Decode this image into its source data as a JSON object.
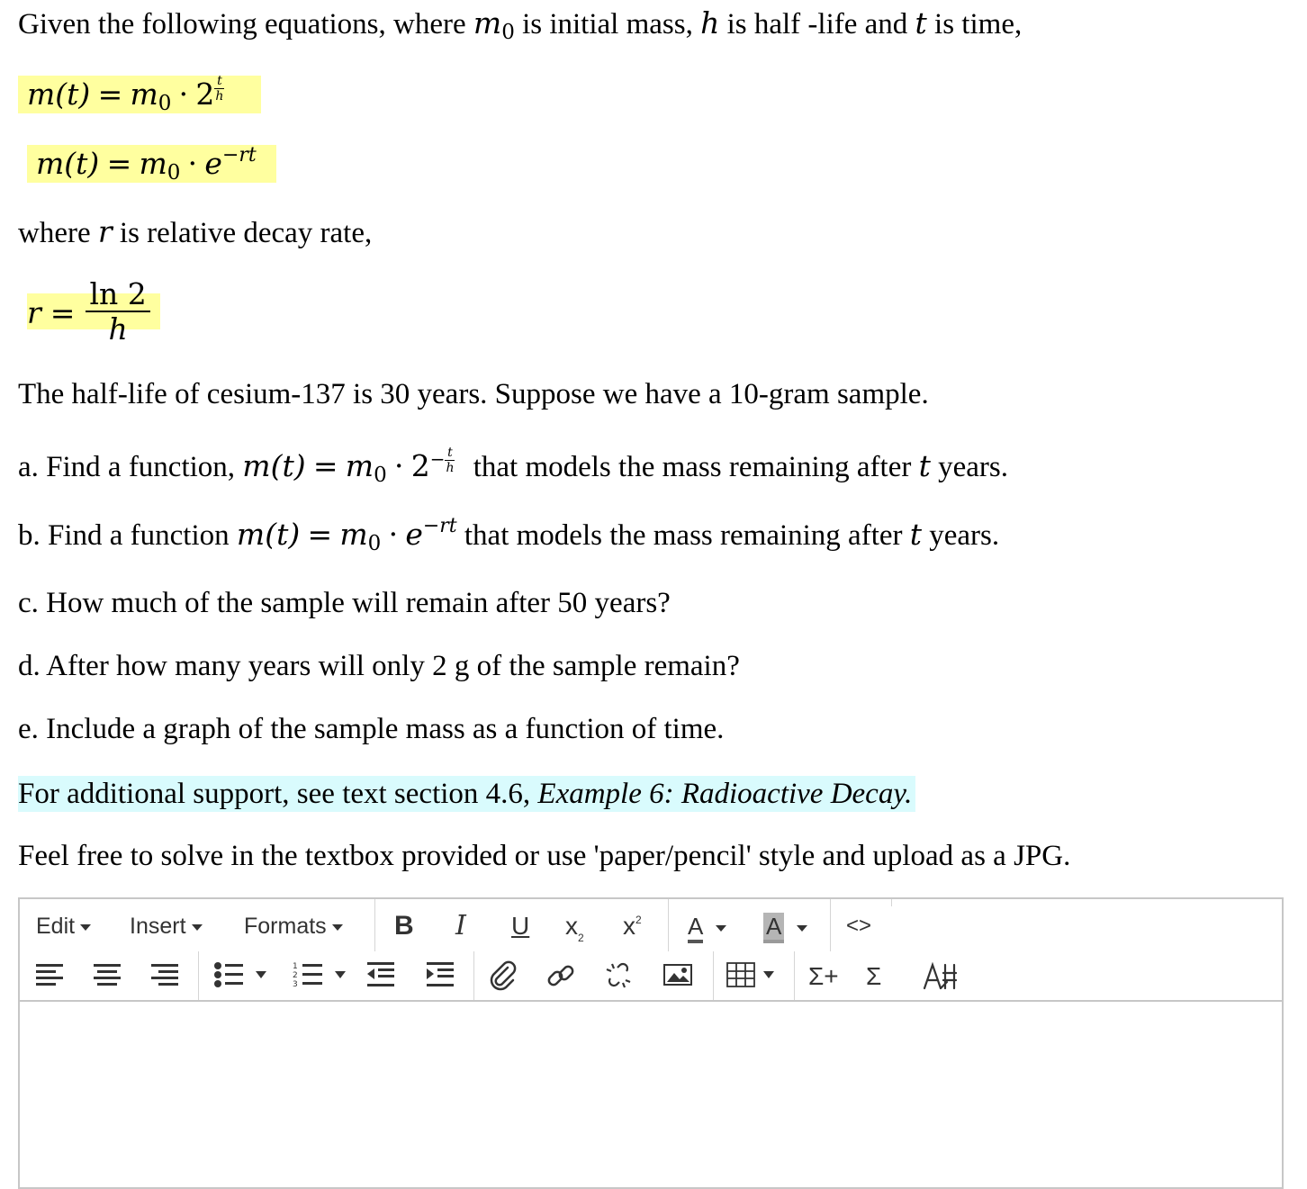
{
  "question": {
    "intro": {
      "p1": "Given the following equations, where ",
      "m0_var": "m",
      "m0_sub": "0",
      "p2": " is initial mass, ",
      "h_var": "h",
      "p3": " is half -life and ",
      "t_var": "t",
      "p4": " is time,"
    },
    "eq1": {
      "lhs": "m(t)",
      "eq": "=",
      "m": "m",
      "sub": "0",
      "dot": "·",
      "base": "2",
      "exp_num": "t",
      "exp_den": "h"
    },
    "eq2": {
      "lhs": "m(t)",
      "eq": "=",
      "m": "m",
      "sub": "0",
      "dot": "·",
      "base": "e",
      "exp": "−rt"
    },
    "where_r": {
      "p1": "where ",
      "var": "r",
      "p2": " is relative decay rate,"
    },
    "eq3": {
      "lhs": "r",
      "eq": "=",
      "num": "ln 2",
      "den": "h"
    },
    "problem": "The half-life of cesium-137 is 30 years. Suppose we have a 10-gram sample.",
    "part_a": {
      "p1": "a. Find a function, ",
      "lhs": "m(t)",
      "eq": "=",
      "m": "m",
      "sub": "0",
      "dot": "·",
      "base": "2",
      "minus": "−",
      "exp_num": "t",
      "exp_den": "h",
      "p2": " that models the mass remaining after ",
      "t": "t",
      "p3": " years."
    },
    "part_b": {
      "p1": "b. Find a function ",
      "lhs": "m(t)",
      "eq": "=",
      "m": "m",
      "sub": "0",
      "dot": "·",
      "base": "e",
      "exp": "−rt",
      "p2": " that models the mass remaining after ",
      "t": "t",
      "p3": " years."
    },
    "part_c": "c. How much of the sample will remain after 50 years?",
    "part_d": "d.  After how many years will only 2 g of the sample remain?",
    "part_e": "e. Include a graph of the sample mass as a function of time.",
    "support": {
      "p1": "For additional support, see text section 4.6, ",
      "example": "Example 6: Radioactive Decay."
    },
    "instructions": "Feel free to solve in the textbox provided or use 'paper/pencil' style and upload as a JPG."
  },
  "editor": {
    "menus": {
      "edit": "Edit",
      "insert": "Insert",
      "formats": "Formats"
    },
    "icons": {
      "bold": "B",
      "italic": "I",
      "underline": "U",
      "subscript": "x",
      "sub_mark": "2",
      "superscript": "x",
      "sup_mark": "2",
      "text_color": "A",
      "bg_color": "A",
      "code": "<>",
      "sigma_plus": "Σ+",
      "sigma": "Σ"
    },
    "colors": {
      "text_color_bar": "#555555",
      "bg_color_bar": "#9a9a9a",
      "bg_color_fill": "#b5b5b5",
      "yellow_highlight": "#ffff9f",
      "cyan_highlight": "#d9fbfd"
    },
    "content": ""
  }
}
